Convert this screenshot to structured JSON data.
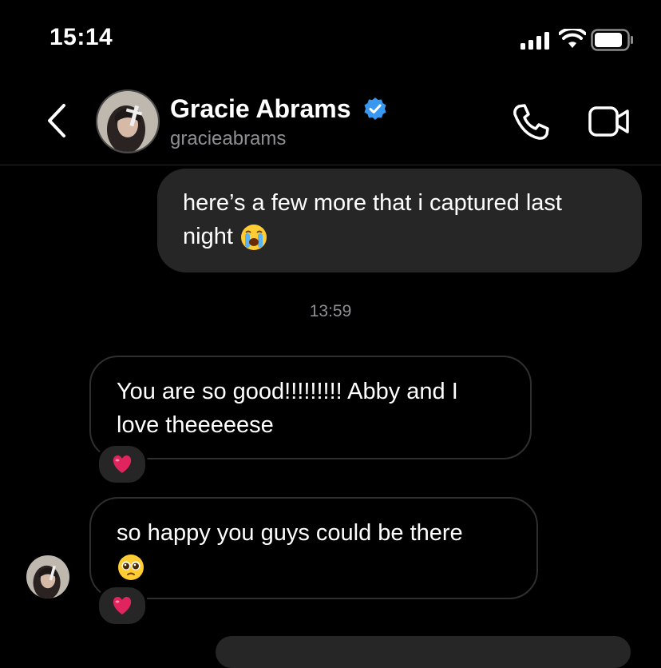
{
  "status_bar": {
    "time": "15:14"
  },
  "header": {
    "name": "Gracie Abrams",
    "handle": "gracieabrams",
    "verified": true,
    "icons": [
      "back-chevron-icon",
      "verified-badge-icon",
      "phone-icon",
      "video-camera-icon"
    ]
  },
  "messages": [
    {
      "from": "me",
      "text": "here’s a few more that i captured last night",
      "emoji": "loudly-crying-face"
    },
    {
      "type": "timestamp",
      "text": "13:59"
    },
    {
      "from": "them",
      "text": "You are so good!!!!!!!!! Abby and I love theeeeese",
      "reaction": "red-heart"
    },
    {
      "from": "them",
      "text": "so happy you guys could be there",
      "emoji": "pleading-face",
      "reaction": "red-heart"
    }
  ],
  "colors": {
    "bg": "#000000",
    "bubble_out": "#262626",
    "secondary_text": "#8e8e93",
    "verified": "#3897f0",
    "heart": "#e0245e"
  }
}
